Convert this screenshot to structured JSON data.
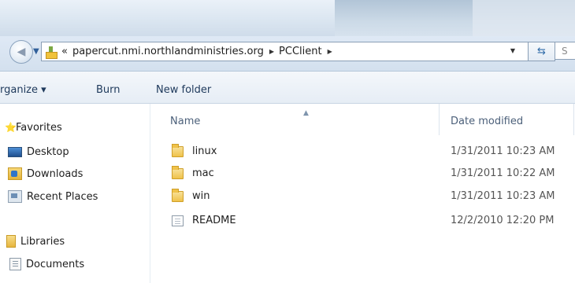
{
  "address": {
    "overflow_chevron": "«",
    "crumbs": [
      "papercut.nmi.northlandministries.org",
      "PCClient"
    ],
    "search_placeholder": "S"
  },
  "toolbar": {
    "organize_label": "rganize ▾",
    "burn_label": "Burn",
    "new_folder_label": "New folder"
  },
  "sidebar": {
    "items": [
      {
        "label": "Favorites",
        "icon": "star-icon"
      },
      {
        "label": "Desktop",
        "icon": "desktop-icon"
      },
      {
        "label": "Downloads",
        "icon": "downloads-icon"
      },
      {
        "label": "Recent Places",
        "icon": "recent-places-icon"
      },
      {
        "label": "Libraries",
        "icon": "libraries-icon"
      },
      {
        "label": "Documents",
        "icon": "documents-icon"
      }
    ]
  },
  "columns": {
    "name": "Name",
    "date_modified": "Date modified"
  },
  "files": [
    {
      "name": "linux",
      "type": "folder",
      "date": "1/31/2011 10:23 AM"
    },
    {
      "name": "mac",
      "type": "folder",
      "date": "1/31/2011 10:22 AM"
    },
    {
      "name": "win",
      "type": "folder",
      "date": "1/31/2011 10:23 AM"
    },
    {
      "name": "README",
      "type": "file",
      "date": "12/2/2010 12:20 PM"
    }
  ],
  "colors": {
    "accent": "#1e395b",
    "folder": "#efc24a"
  }
}
